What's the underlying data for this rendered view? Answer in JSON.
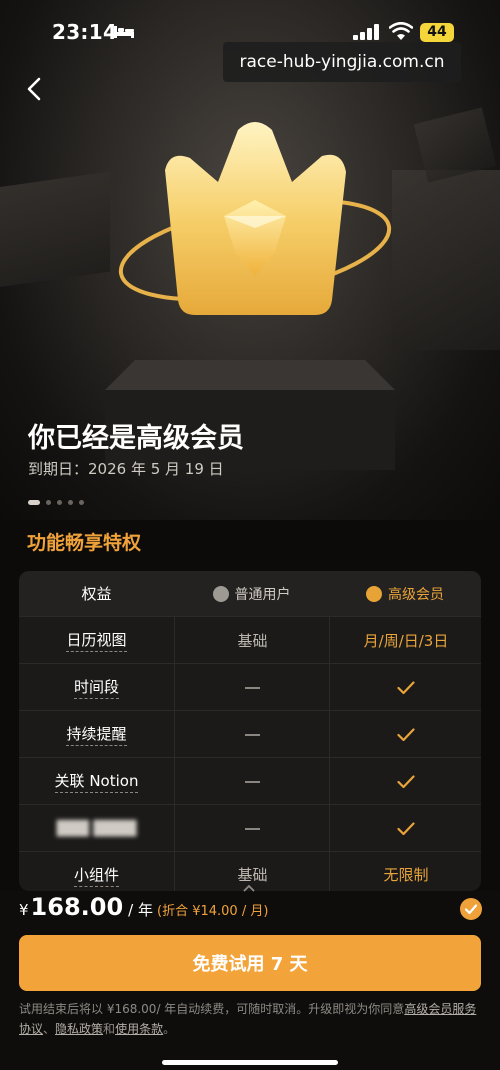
{
  "status_bar": {
    "time": "23:14",
    "battery": "44"
  },
  "watermark": "race-hub-yingjia.com.cn",
  "hero": {
    "title": "你已经是高级会员",
    "expire_text": "到期日：2026 年 5 月 19 日",
    "carousel_dots": 5,
    "active_dot": 0
  },
  "section_title": "功能畅享特权",
  "table": {
    "headers": {
      "feature": "权益",
      "free": "普通用户",
      "premium": "高级会员"
    },
    "rows": [
      {
        "feature": "日历视图",
        "free": "基础",
        "premium": "月/周/日/3日"
      },
      {
        "feature": "时间段",
        "free": "dash",
        "premium": "check"
      },
      {
        "feature": "持续提醒",
        "free": "dash",
        "premium": "check"
      },
      {
        "feature": "关联 Notion",
        "free": "dash",
        "premium": "check"
      },
      {
        "feature": "███ ████",
        "free": "dash",
        "premium": "check"
      },
      {
        "feature": "小组件",
        "free": "基础",
        "premium": "无限制"
      }
    ]
  },
  "purchase": {
    "currency": "¥",
    "price": "168.00",
    "unit": "/ 年",
    "monthly_note": "(折合 ¥14.00 / 月)",
    "selected": true,
    "cta_label": "免费试用 7 天"
  },
  "terms": {
    "text": "试用结束后将以 ¥168.00/ 年自动续费，可随时取消。升级即视为你同意",
    "link_membership": "高级会员服务协议",
    "sep1": "、",
    "link_privacy": "隐私政策",
    "sep2": "和",
    "link_usage": "使用条款",
    "end": "。"
  },
  "colors": {
    "accent": "#f2a43a",
    "background": "#0c0b0a",
    "table_bg": "#1b1a19"
  },
  "icons": [
    "bed-icon",
    "signal-icon",
    "wifi-icon",
    "back-arrow-icon",
    "crown-icon",
    "check-icon",
    "dash-icon",
    "chevron-up-icon"
  ]
}
